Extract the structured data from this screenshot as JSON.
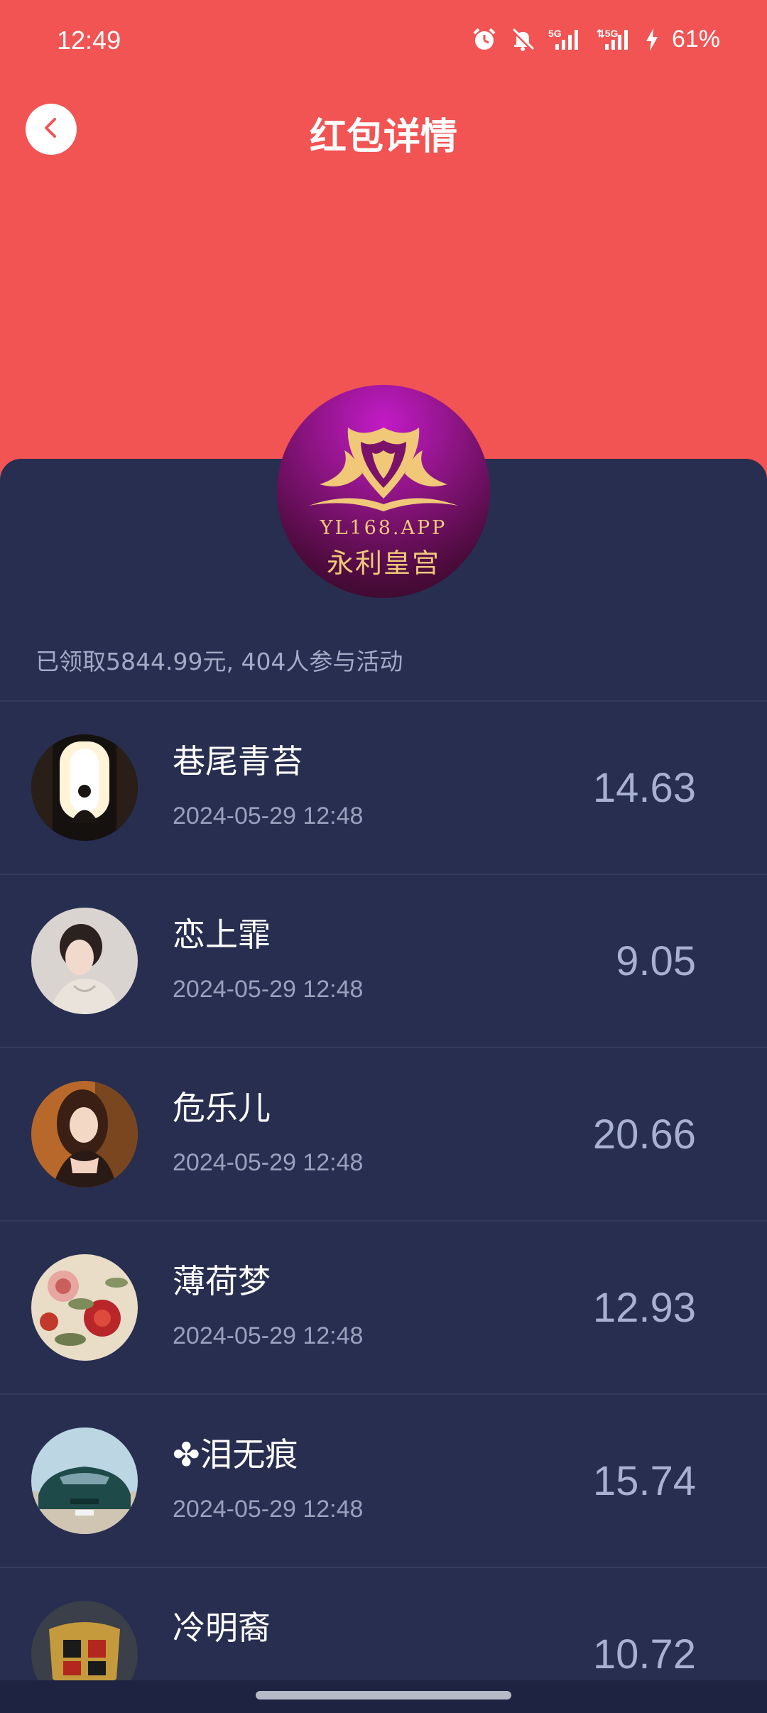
{
  "status_bar": {
    "time": "12:49",
    "battery": "61%",
    "network_1": "5G",
    "network_2": "5G",
    "icons": [
      "alarm-icon",
      "mute-icon",
      "signal-5g-icon",
      "signal-5g-icon",
      "charging-icon"
    ]
  },
  "header": {
    "title": "红包详情",
    "back_icon": "chevron-left-icon",
    "background_color": "#f25353"
  },
  "logo": {
    "text_en": "YL168.APP",
    "text_cn": "永利皇宫"
  },
  "summary": {
    "text": "已领取5844.99元, 404人参与活动"
  },
  "records": [
    {
      "name": "巷尾青苔",
      "time": "2024-05-29 12:48",
      "amount": "14.63",
      "avatar": "meditation-avatar"
    },
    {
      "name": "恋上霏",
      "time": "2024-05-29 12:48",
      "amount": "9.05",
      "avatar": "girl-portrait-avatar"
    },
    {
      "name": "危乐儿",
      "time": "2024-05-29 12:48",
      "amount": "20.66",
      "avatar": "girl-portrait-avatar"
    },
    {
      "name": "薄荷梦",
      "time": "2024-05-29 12:48",
      "amount": "12.93",
      "avatar": "peony-flower-avatar"
    },
    {
      "name": "✤泪无痕",
      "time": "2024-05-29 12:48",
      "amount": "15.74",
      "avatar": "sports-car-avatar"
    },
    {
      "name": "冷明裔",
      "time": "",
      "amount": "10.72",
      "avatar": "car-emblem-avatar"
    }
  ],
  "colors": {
    "panel": "#272e4f",
    "amount": "#a8b1cf",
    "timestamp": "#9aa1bd",
    "gold": "#f0c878"
  }
}
